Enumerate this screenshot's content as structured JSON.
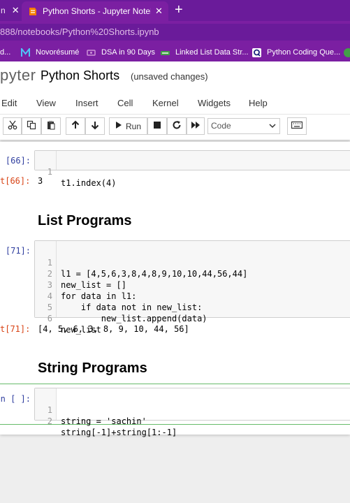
{
  "browser": {
    "tabs": [
      {
        "title": "n",
        "active": false
      },
      {
        "title": "Python Shorts - Jupyter Notebook",
        "active": true
      }
    ],
    "new_tab": "+",
    "close_glyph": "✕",
    "url": "888/notebooks/Python%20Shorts.ipynb",
    "bookmarks": [
      {
        "label": "d...",
        "icon": "bookmark-icon"
      },
      {
        "label": "Novorésumé",
        "icon": "novoresume-icon"
      },
      {
        "label": "DSA in 90 Days",
        "icon": "dsa-icon"
      },
      {
        "label": "Linked List Data Str...",
        "icon": "linkedlist-icon"
      },
      {
        "label": "Python Coding Que...",
        "icon": "q-icon"
      }
    ],
    "colors": {
      "chrome": "#7b1fa2",
      "tabbar": "#6a1b9a"
    }
  },
  "jupyter": {
    "logo": "pyter",
    "notebook_name": "Python Shorts",
    "status": "(unsaved changes)",
    "menu": [
      "Edit",
      "View",
      "Insert",
      "Cell",
      "Kernel",
      "Widgets",
      "Help"
    ],
    "toolbar": {
      "run_label": "Run",
      "cell_type": "Code"
    }
  },
  "cells": {
    "c1": {
      "prompt": "[66]:",
      "lines": [
        "t1.index(4)"
      ],
      "out_prompt": "t[66]:",
      "output": "3"
    },
    "h1": {
      "text": "List Programs"
    },
    "c2": {
      "prompt": "[71]:",
      "lines": [
        "l1 = [4,5,6,3,8,4,8,9,10,10,44,56,44]",
        "new_list = []",
        "for data in l1:",
        "    if data not in new_list:",
        "        new_list.append(data)",
        "new_list"
      ],
      "out_prompt": "t[71]:",
      "output": "[4, 5, 6, 3, 8, 9, 10, 44, 56]"
    },
    "h2": {
      "text": "String Programs"
    },
    "c3": {
      "prompt": "n [ ]:",
      "lines": [
        "string = 'sachin'",
        "string[-1]+string[1:-1]"
      ]
    }
  },
  "line_numbers": [
    "1",
    "2",
    "3",
    "4",
    "5",
    "6"
  ]
}
